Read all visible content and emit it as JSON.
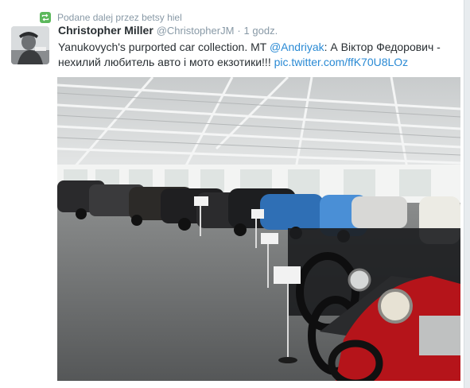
{
  "retweet": {
    "text": "Podane dalej przez betsy hiel",
    "icon": "retweet-icon"
  },
  "tweet": {
    "author_name": "Christopher Miller",
    "author_handle": "@ChristopherJM",
    "separator": "·",
    "time": "1 godz.",
    "text_part1": "Yanukovych's purported car collection. MT ",
    "mention": "@Andriyak",
    "text_part2": ": А Віктор Федорович - нехилий любитель авто і мото екзотики!!! ",
    "link": "pic.twitter.com/ffK70U8LOz"
  },
  "colors": {
    "link": "#2a8ad4",
    "meta": "#8899a6",
    "retweet_green": "#5cb85c",
    "text": "#292f33"
  }
}
